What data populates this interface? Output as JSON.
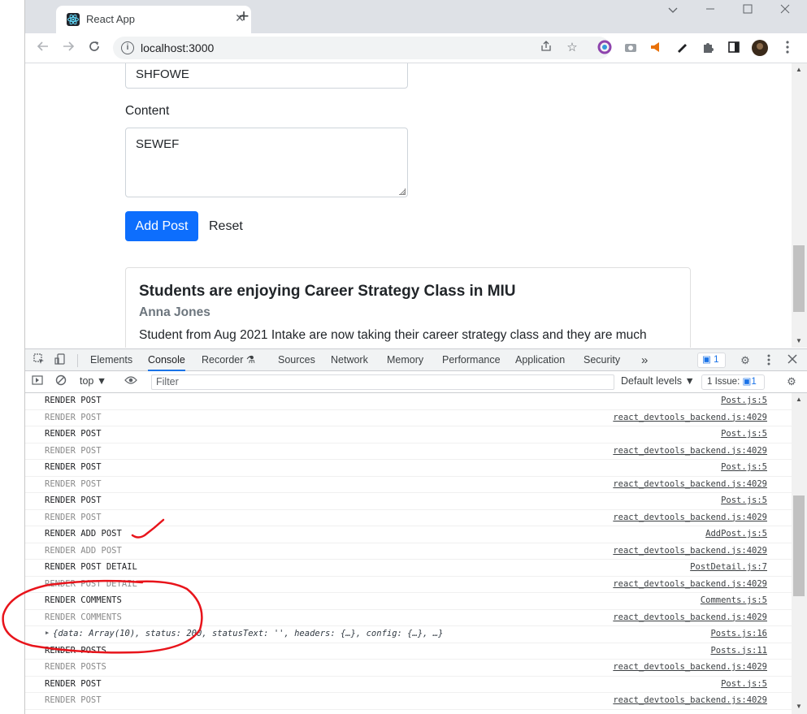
{
  "browser": {
    "tab_title": "React App",
    "tab_close": "✕",
    "new_tab": "+",
    "url": "localhost:3000",
    "window_controls": [
      "chevron-down-icon",
      "minimize-icon",
      "maximize-icon",
      "close-icon"
    ]
  },
  "form": {
    "title_value": "SHFOWE",
    "content_label": "Content",
    "content_value": "SEWEF",
    "add_post_label": "Add Post",
    "reset_label": "Reset",
    "primary_color": "#0d6efd"
  },
  "post": {
    "title": "Students are enjoying Career Strategy Class in MIU",
    "author": "Anna Jones",
    "excerpt": "Student from Aug 2021 Intake are now taking their career strategy class and they are much"
  },
  "devtools": {
    "tabs": [
      "Elements",
      "Console",
      "Recorder ⚗",
      "Sources",
      "Network",
      "Memory",
      "Performance",
      "Application",
      "Security",
      "»"
    ],
    "active_tab": "Console",
    "issues_badge": "1",
    "context": "top ▼",
    "filter_placeholder": "Filter",
    "default_levels": "Default levels ▼",
    "issue_count_label": "1 Issue:",
    "issue_count_value": "1"
  },
  "console_rows": [
    {
      "msg": "RENDER POST",
      "src": "Post.js:5",
      "dim": false
    },
    {
      "msg": "RENDER POST",
      "src": "react_devtools_backend.js:4029",
      "dim": true
    },
    {
      "msg": "RENDER POST",
      "src": "Post.js:5",
      "dim": false
    },
    {
      "msg": "RENDER POST",
      "src": "react_devtools_backend.js:4029",
      "dim": true
    },
    {
      "msg": "RENDER POST",
      "src": "Post.js:5",
      "dim": false
    },
    {
      "msg": "RENDER POST",
      "src": "react_devtools_backend.js:4029",
      "dim": true
    },
    {
      "msg": "RENDER POST",
      "src": "Post.js:5",
      "dim": false
    },
    {
      "msg": "RENDER POST",
      "src": "react_devtools_backend.js:4029",
      "dim": true
    },
    {
      "msg": "RENDER ADD POST",
      "src": "AddPost.js:5",
      "dim": false
    },
    {
      "msg": "RENDER ADD POST",
      "src": "react_devtools_backend.js:4029",
      "dim": true
    },
    {
      "msg": "RENDER POST DETAIL",
      "src": "PostDetail.js:7",
      "dim": false
    },
    {
      "msg": "RENDER POST DETAIL",
      "src": "react_devtools_backend.js:4029",
      "dim": true
    },
    {
      "msg": "RENDER COMMENTS",
      "src": "Comments.js:5",
      "dim": false
    },
    {
      "msg": "RENDER COMMENTS",
      "src": "react_devtools_backend.js:4029",
      "dim": true
    },
    {
      "msg": "{data: Array(10), status: 200, statusText: '', headers: {…}, config: {…}, …}",
      "src": "Posts.js:16",
      "obj": true
    },
    {
      "msg": "RENDER POSTS",
      "src": "Posts.js:11",
      "dim": false
    },
    {
      "msg": "RENDER POSTS",
      "src": "react_devtools_backend.js:4029",
      "dim": true
    },
    {
      "msg": "RENDER POST",
      "src": "Post.js:5",
      "dim": false
    },
    {
      "msg": "RENDER POST",
      "src": "react_devtools_backend.js:4029",
      "dim": true
    }
  ],
  "annotation_color": "#e8141b"
}
